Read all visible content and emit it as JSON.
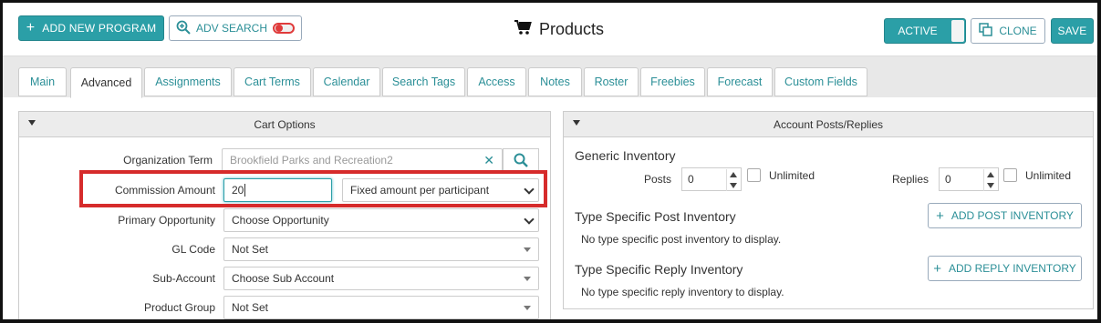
{
  "header": {
    "add_program_label": "ADD NEW PROGRAM",
    "adv_search_label": "ADV SEARCH",
    "title": "Products",
    "active_label": "ACTIVE",
    "clone_label": "CLONE",
    "save_label": "SAVE"
  },
  "tabs": [
    {
      "label": "Main"
    },
    {
      "label": "Advanced"
    },
    {
      "label": "Assignments"
    },
    {
      "label": "Cart Terms"
    },
    {
      "label": "Calendar"
    },
    {
      "label": "Search Tags"
    },
    {
      "label": "Access"
    },
    {
      "label": "Notes"
    },
    {
      "label": "Roster"
    },
    {
      "label": "Freebies"
    },
    {
      "label": "Forecast"
    },
    {
      "label": "Custom Fields"
    }
  ],
  "cart_options": {
    "title": "Cart Options",
    "org_term_label": "Organization Term",
    "org_term_placeholder": "Brookfield Parks and Recreation2",
    "commission_label": "Commission Amount",
    "commission_value": "20",
    "commission_type": "Fixed amount per participant",
    "primary_opp_label": "Primary Opportunity",
    "primary_opp_value": "Choose Opportunity",
    "gl_code_label": "GL Code",
    "gl_code_value": "Not Set",
    "sub_account_label": "Sub-Account",
    "sub_account_value": "Choose Sub Account",
    "product_group_label": "Product Group",
    "product_group_value": "Not Set"
  },
  "account_posts": {
    "title": "Account Posts/Replies",
    "generic_inventory": "Generic Inventory",
    "posts_label": "Posts",
    "posts_value": "0",
    "unlimited_label": "Unlimited",
    "replies_label": "Replies",
    "replies_value": "0",
    "type_post_title": "Type Specific Post Inventory",
    "add_post_label": "ADD POST INVENTORY",
    "no_post_text": "No type specific post inventory to display.",
    "type_reply_title": "Type Specific Reply Inventory",
    "add_reply_label": "ADD REPLY INVENTORY",
    "no_reply_text": "No type specific reply inventory to display."
  }
}
